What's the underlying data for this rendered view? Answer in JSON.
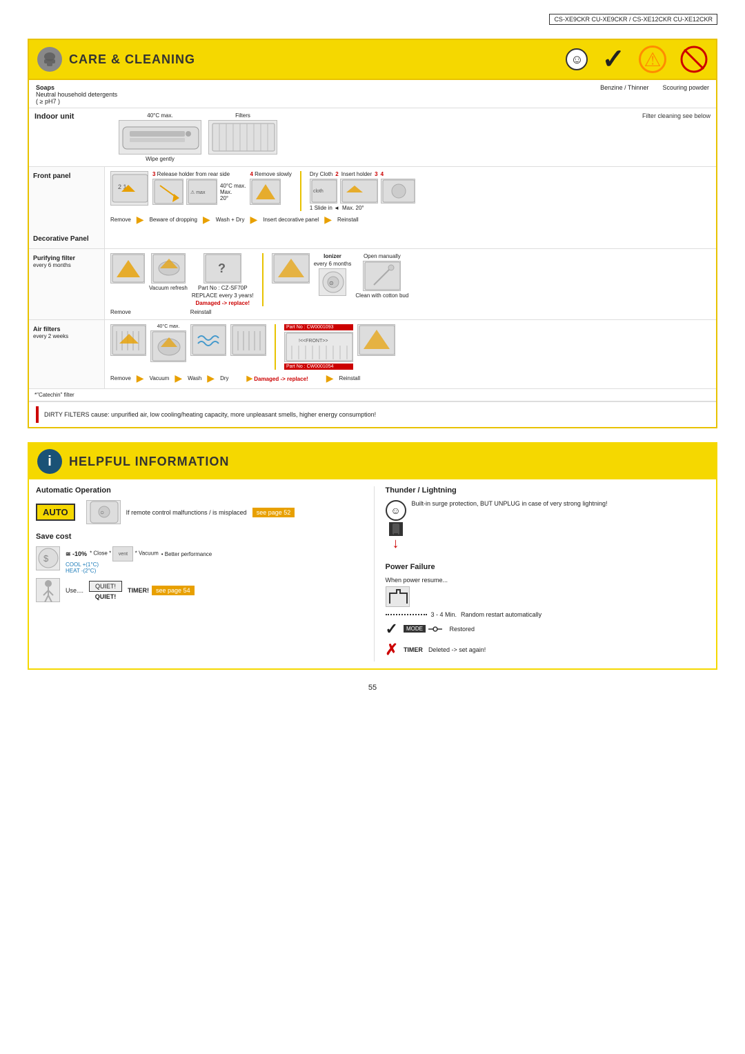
{
  "page": {
    "model_header": "CS-XE9CKR CU-XE9CKR / CS-XE12CKR CU-XE12CKR",
    "page_number": "55"
  },
  "care_section": {
    "title": "CARE & CLEANING",
    "products": {
      "ok_label": "Soaps",
      "ok_sub": "Neutral household detergents",
      "ok_ph": "( ≥ pH7 )",
      "no1": "Benzine / Thinner",
      "no2": "Scouring powder"
    },
    "indoor_unit": {
      "label": "Indoor unit",
      "wipe_note": "Wipe gently",
      "temp_note": "40°C max.",
      "filters_label": "Filters",
      "filter_cleaning_note": "Filter cleaning see below"
    },
    "front_panel": {
      "label": "Front panel",
      "steps": [
        {
          "num": "3",
          "text": "Release holder from rear side"
        },
        {
          "num": "4",
          "text": "Remove slowly"
        },
        {
          "num": "",
          "text": "40°C max. Max. 20°"
        }
      ],
      "filter_steps": [
        {
          "num": "",
          "text": "Dry Cloth"
        },
        {
          "num": "2",
          "text": "Insert holder"
        },
        {
          "num": "3",
          "text": ""
        },
        {
          "num": "4",
          "text": ""
        }
      ],
      "slide_in": "1 Slide in",
      "max_note": "Max. 20°",
      "actions": [
        "Remove",
        "Beware of dropping",
        "Wash + Dry",
        "Insert decorative panel",
        "Reinstall"
      ]
    },
    "decorative_panel": {
      "label": "Decorative Panel"
    },
    "purifying_filter": {
      "label": "Purifying filter",
      "frequency": "every 6 months",
      "part_no": "CZ-SF70P",
      "replace_note": "REPLACE every 3 years!",
      "damaged_note": "Damaged -> replace!",
      "vacuum_label": "Vacuum refresh",
      "ionizer_label": "Ionizer",
      "ionizer_freq": "every 6 months",
      "open_manually": "Open manually",
      "clean_note": "Clean with cotton bud",
      "actions": [
        "Remove",
        "Reinstall"
      ]
    },
    "air_filters": {
      "label": "Air filters",
      "frequency": "every 2 weeks",
      "temp_note": "40°C max.",
      "part_no1": "Part No : CW0001093",
      "part_no2": "Part No : CW0001054",
      "front_label": "!<<FRONT>>",
      "damaged_note": "Damaged -> replace!",
      "actions": [
        "Remove",
        "Vacuum",
        "Wash",
        "Dry",
        "Reinstall"
      ]
    },
    "catechin_note": "*\"Catechin\" filter",
    "dirty_filter_note": "DIRTY FILTERS cause: unpurified air, low cooling/heating capacity, more unpleasant smells, higher energy consumption!"
  },
  "helpful_section": {
    "title": "HELPFUL INFORMATION",
    "auto_operation": {
      "title": "Automatic Operation",
      "auto_label": "AUTO",
      "note": "If remote control malfunctions / is misplaced",
      "see_page": "see page 52"
    },
    "save_cost": {
      "title": "Save cost",
      "percent": "≅ -10%",
      "cool_label": "COOL +(1°C)",
      "heat_label": "HEAT -(2°C)",
      "close_label": "Close",
      "vacuum_label": "Vacuum",
      "better_perf": "• Better performance",
      "use_label": "Use....",
      "quiet_label": "QUIET",
      "quiet_btn": "QUIET!",
      "timer_label": "TIMER!",
      "see_page": "see page 54"
    },
    "thunder": {
      "title": "Thunder / Lightning",
      "note": "Built-in surge protection, BUT UNPLUG in case of very strong lightning!"
    },
    "power_failure": {
      "title": "Power Failure",
      "when_label": "When power resume...",
      "min_label": "3 - 4 Min.",
      "restart_note": "Random restart automatically",
      "mode_label": "MODE",
      "restored_label": "Restored",
      "timer_label": "TIMER",
      "deleted_label": "Deleted -> set again!"
    }
  }
}
